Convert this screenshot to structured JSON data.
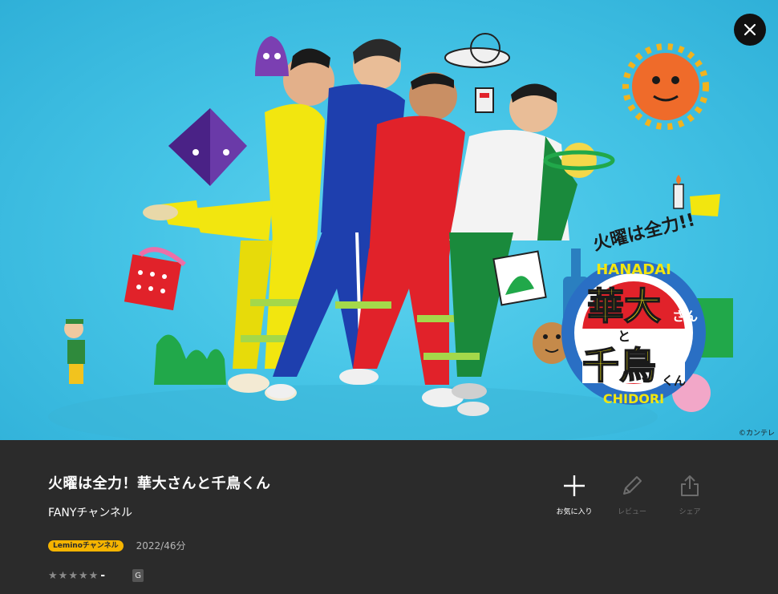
{
  "hero": {
    "copyright": "©カンテレ",
    "logo": {
      "top": "火曜は全力!!",
      "arc_top": "HANADAI",
      "main1": "華大",
      "san": "さん",
      "to": "と",
      "main2": "千鳥",
      "kun": "くん",
      "arc_bottom": "CHIDORI"
    }
  },
  "close_icon": "close-icon",
  "program": {
    "title": "火曜は全力！華大さんと千鳥くん",
    "channel": "FANYチャンネル",
    "badge": "Leminoチャンネル",
    "year_duration": "2022/46分",
    "rating_score": "-",
    "age_rating": "G",
    "stars_filled": 0,
    "stars_total": 5
  },
  "actions": [
    {
      "label": "お気に入り",
      "icon": "plus-icon",
      "enabled": true
    },
    {
      "label": "レビュー",
      "icon": "pencil-icon",
      "enabled": false
    },
    {
      "label": "シェア",
      "icon": "share-icon",
      "enabled": false
    }
  ],
  "colors": {
    "hero_bg": "#45c4e6",
    "panel_bg": "#2b2b2b",
    "badge": "#f5b400"
  }
}
